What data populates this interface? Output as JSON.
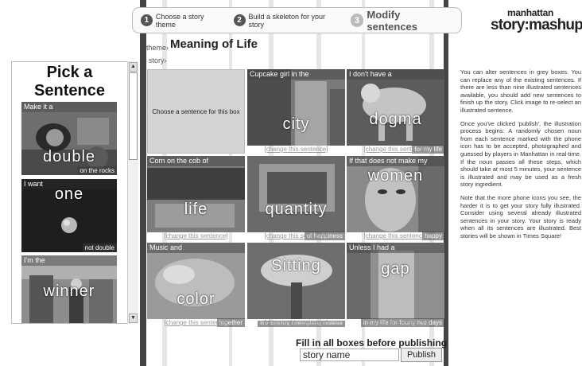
{
  "steps": [
    {
      "num": "1",
      "label": "Choose a story theme"
    },
    {
      "num": "2",
      "label": "Build a skeleton for your story"
    },
    {
      "num": "3",
      "label": "Modify sentences"
    }
  ],
  "logo": {
    "line1": "manhattan",
    "line2": "story:mashup"
  },
  "left_panel": {
    "title_line1": "Pick a",
    "title_line2": "Sentence",
    "cards": [
      {
        "top": "Make it a",
        "noun": "double",
        "bottom": "on the rocks"
      },
      {
        "top": "I want",
        "noun": "one",
        "bottom": "not double"
      },
      {
        "top": "I'm the",
        "noun": "winner",
        "bottom": ""
      }
    ]
  },
  "theme": {
    "label": "theme",
    "title": "Meaning of Life"
  },
  "story": {
    "label": "story"
  },
  "grid": {
    "empty_text": "Choose a sentence for this box",
    "change_label": "[change this sentence]",
    "cells": [
      {
        "top": "Cupcake girl in the",
        "noun": "city",
        "bottom": ""
      },
      {
        "top": "I don't have a",
        "noun": "dogma",
        "bottom": "for my life"
      },
      {
        "top": "Corn on the cob of",
        "noun": "life",
        "bottom": ""
      },
      {
        "top": "",
        "noun": "quantity",
        "bottom": "of happiness"
      },
      {
        "top": "If that does not make my",
        "noun": "women",
        "bottom": "happy"
      },
      {
        "top": "Music and",
        "noun": "color",
        "bottom": "together"
      },
      {
        "top": "",
        "noun": "Sitting",
        "bottom": "in a dormitory, contemplating existence"
      },
      {
        "top": "Unless I had a",
        "noun": "gap",
        "bottom": "in my life for fourty two days"
      }
    ]
  },
  "publish": {
    "fill_label": "Fill in all boxes before publishing",
    "story_name_value": "story name",
    "button_label": "Publish"
  },
  "instructions": [
    "You can alter sentences in grey boxes. You can replace any of the existing sentences. If there are less than nine illustrated sentences available, you should add new sentences to finish up the story. Click image to re-select an illustrated sentence.",
    "Once you've clicked 'publish', the illustration process begins: A randomly chosen noun from each sentence marked with the phone icon has to be accepted, photographed and guessed by players in Manhattan in real-time. If the noun passes all these steps, which should take at most 5 minutes, your sentence is illustrated and may be used as a fresh story ingredient.",
    "Note that the more phone icons you see, the harder it is to get your story fully illustrated. Consider using several already illustrated sentences in your story. Your story is ready when all its sentences are illustrated. Best stories will be shown in Times Square!"
  ]
}
